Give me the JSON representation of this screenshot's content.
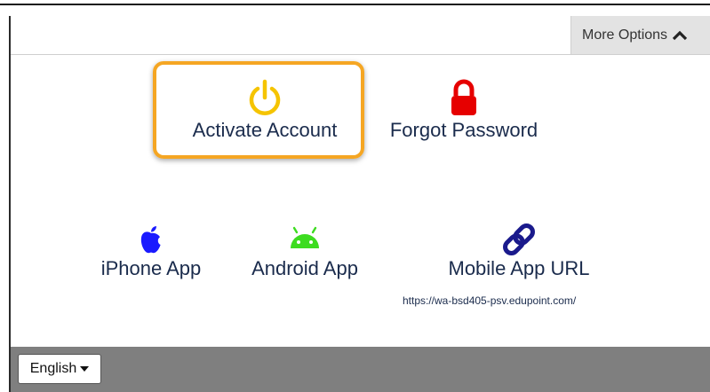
{
  "header": {
    "more_options_label": "More Options"
  },
  "tiles": {
    "activate": {
      "label": "Activate Account",
      "icon": "power-icon",
      "color": "#f5c400"
    },
    "forgot": {
      "label": "Forgot Password",
      "icon": "lock-icon",
      "color": "#e60000"
    },
    "iphone": {
      "label": "iPhone App",
      "icon": "apple-icon",
      "color": "#1a1aff"
    },
    "android": {
      "label": "Android App",
      "icon": "android-icon",
      "color": "#3ddc20"
    },
    "mobile": {
      "label": "Mobile App URL",
      "icon": "link-icon",
      "color": "#1a1a8c",
      "url": "https://wa-bsd405-psv.edupoint.com/"
    }
  },
  "footer": {
    "language": "English"
  },
  "colors": {
    "highlight": "#f5a623",
    "footer_bg": "#7f7f7f",
    "text": "#1a2b4c"
  }
}
